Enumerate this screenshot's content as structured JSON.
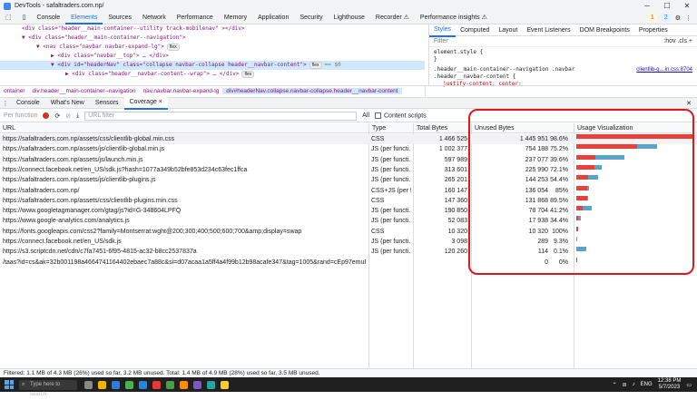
{
  "window": {
    "title": "DevTools - safaltraders.com.np/"
  },
  "tabs": [
    "Console",
    "Elements",
    "Sources",
    "Network",
    "Performance",
    "Memory",
    "Application",
    "Security",
    "Lighthouse",
    "Recorder ⚠",
    "Performance insights ⚠"
  ],
  "active_tab": "Elements",
  "badges": {
    "warnings": "1",
    "issues": "2"
  },
  "dom_lines": [
    {
      "indent": 6,
      "text": "<div class=\"header__main-container--utility track-mobilenav\" ></div>",
      "sel": false
    },
    {
      "indent": 6,
      "text": "▼ <div class=\"header__main-container--navigation\">",
      "sel": false
    },
    {
      "indent": 10,
      "text": "▼ <nav class=\"navbar navbar-expand-lg\">",
      "flex": "flex",
      "sel": false
    },
    {
      "indent": 14,
      "text": "▶ <div class=\"navbar__top\"> … </div>",
      "sel": false
    },
    {
      "indent": 14,
      "text": "▼ <div id=\"headerNav\" class=\"collapse navbar-collapse header__navbar-content\">",
      "flex": "flex",
      "eq": "== $0",
      "sel": true
    },
    {
      "indent": 18,
      "text": "▶ <div class=\"header__navbar-content--wrap\"> … </div>",
      "flex": "flex",
      "sel": false
    }
  ],
  "styles_tabs": [
    "Styles",
    "Computed",
    "Layout",
    "Event Listeners",
    "DOM Breakpoints",
    "Properties"
  ],
  "styles_filter": {
    "placeholder": "Filter",
    "controls": ":hov .cls +"
  },
  "styles_code": {
    "line1": "element.style {",
    "line2": "}",
    "sel1": ".header__main-container--navigation .navbar",
    "sel2": ".header__navbar-content {",
    "prop": "justify-content: center;",
    "link": "clientlib-g…in.css:8704"
  },
  "breadcrumbs": [
    "ontainer",
    "div.header__main-container--navigation",
    "nav.navbar.navbar-expand-lg",
    "div#headerNav.collapse.navbar-collapse.header__navbar-content"
  ],
  "drawer_tabs": [
    "Console",
    "What's New",
    "Sensors",
    "Coverage ×"
  ],
  "coverage_toolbar": {
    "mode": "Per function",
    "url_filter": "URL filter",
    "content_scripts": "Content scripts",
    "all": "All"
  },
  "columns": [
    "URL",
    "Type",
    "Total Bytes",
    "Unused Bytes",
    "Usage Visualization"
  ],
  "rows": [
    {
      "url": "https://safaltraders.com.np/assets/css/clientlib-global.min.css",
      "type": "CSS",
      "total": "1 466 525",
      "unused": "1 445 951",
      "pct": "98.6%",
      "used_frac": 0.014,
      "width_frac": 1.0
    },
    {
      "url": "https://safaltraders.com.np/assets/js/clientlib-global.min.js",
      "type": "JS (per functi…",
      "total": "1 002 377",
      "unused": "754 188",
      "pct": "75.2%",
      "used_frac": 0.248,
      "width_frac": 0.684
    },
    {
      "url": "https://safaltraders.com.np/assets/js/launch.min.js",
      "type": "JS (per functi…",
      "total": "597 989",
      "unused": "237 077",
      "pct": "39.6%",
      "used_frac": 0.604,
      "width_frac": 0.408
    },
    {
      "url": "https://connect.facebook.net/en_US/sdk.js?hash=1077a349b52bfe853d234c63fec1ffca",
      "type": "JS (per functi…",
      "total": "313 601",
      "unused": "225 990",
      "pct": "72.1%",
      "used_frac": 0.279,
      "width_frac": 0.214
    },
    {
      "url": "https://safaltraders.com.np/assets/js/clientlib-plugins.js",
      "type": "JS (per functi…",
      "total": "265 201",
      "unused": "144 253",
      "pct": "54.4%",
      "used_frac": 0.456,
      "width_frac": 0.181
    },
    {
      "url": "https://safaltraders.com.np/",
      "type": "CSS+JS (per fu…",
      "total": "160 147",
      "unused": "136 054",
      "pct": "85%",
      "used_frac": 0.15,
      "width_frac": 0.109
    },
    {
      "url": "https://safaltraders.com.np/assets/css/clientlib-plugins.min.css",
      "type": "CSS",
      "total": "147 360",
      "unused": "131 868",
      "pct": "89.5%",
      "used_frac": 0.105,
      "width_frac": 0.1
    },
    {
      "url": "https://www.googletagmanager.com/gtag/js?id=G-348604LPFQ",
      "type": "JS (per functi…",
      "total": "190 850",
      "unused": "78 704",
      "pct": "41.2%",
      "used_frac": 0.588,
      "width_frac": 0.13
    },
    {
      "url": "https://www.google-analytics.com/analytics.js",
      "type": "JS (per functi…",
      "total": "52 083",
      "unused": "17 938",
      "pct": "34.4%",
      "used_frac": 0.656,
      "width_frac": 0.036
    },
    {
      "url": "https://fonts.googleapis.com/css2?family=Montserrat:wght@200;300;400;500;600;700&amp;display=swap",
      "type": "CSS",
      "total": "10 320",
      "unused": "10 320",
      "pct": "100%",
      "used_frac": 0.0,
      "width_frac": 0.007
    },
    {
      "url": "https://connect.facebook.net/en_US/sdk.js",
      "type": "JS (per functi…",
      "total": "3 098",
      "unused": "289",
      "pct": "9.3%",
      "used_frac": 0.907,
      "width_frac": 0.0021
    },
    {
      "url": "https://s3.scriptcdn.net/cdn/c7fa7451-6f95-4815-ac32-b8cc2537837a",
      "type": "JS (per functi…",
      "total": "120 260",
      "unused": "114",
      "pct": "0.1%",
      "used_frac": 0.999,
      "width_frac": 0.082
    },
    {
      "url": "/taas?id=cs&ak=32b001198a4664741164402ebaec7a88c&si=d07acaa1a5ff4a4f99b12b98acafe347&tag=1005&rand=cEp97emuRQMelfm",
      "type": "",
      "total": "",
      "unused": "0",
      "pct": "0%",
      "used_frac": 0.0,
      "width_frac": 0.0
    }
  ],
  "status_text": "Filtered: 1.1 MB of 4.3 MB (26%) used so far, 3.2 MB unused. Total: 1.4 MB of 4.9 MB (28%) used so far, 3.5 MB unused.",
  "taskbar": {
    "search": "Type here to search",
    "lang": "ENG",
    "time": "12:38 PM",
    "date": "5/7/2023"
  },
  "colors": {
    "unused": "#e8403a",
    "used": "#5ba4c9",
    "highlight": "#e4161b",
    "accent": "#1a73e8"
  }
}
